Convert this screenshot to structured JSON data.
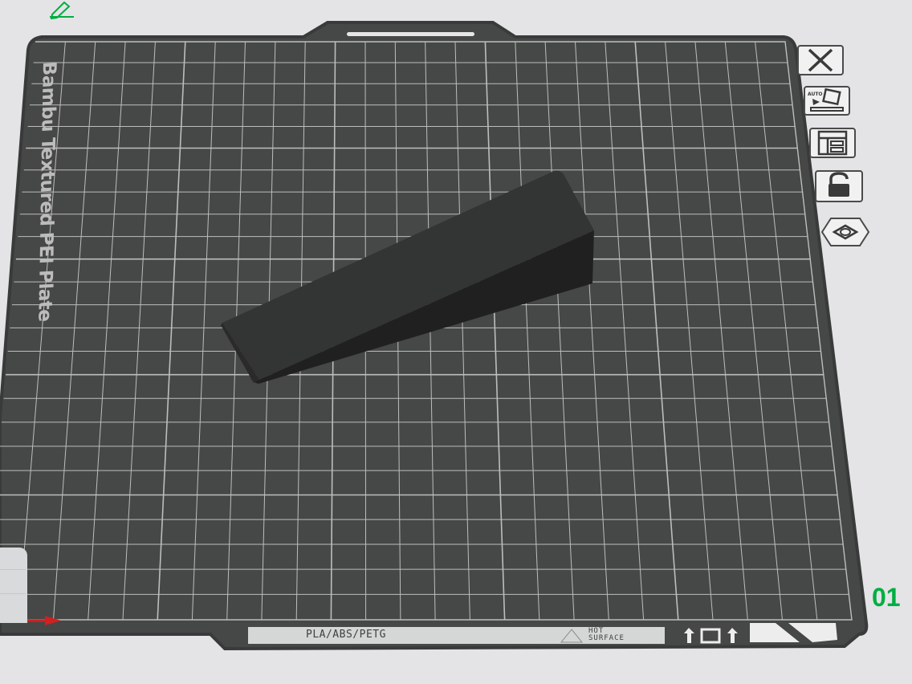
{
  "plate": {
    "label": "Bambu Textured PEI Plate",
    "number": "01",
    "material": "PLA/ABS/PETG",
    "hot_surface": [
      "HOT",
      "SURFACE"
    ]
  },
  "toolbar": {
    "buttons": [
      {
        "name": "close-plate-button",
        "icon": "close-icon"
      },
      {
        "name": "auto-orient-button",
        "icon": "auto-orient-icon",
        "text": "AUTO"
      },
      {
        "name": "arrange-button",
        "icon": "arrange-icon"
      },
      {
        "name": "lock-plate-button",
        "icon": "lock-icon"
      },
      {
        "name": "plate-settings-button",
        "icon": "hexagon-nut-icon"
      }
    ]
  },
  "colors": {
    "background": "#e4e4e6",
    "plate": "#464747",
    "plate_frame": "#3a3b3b",
    "grid_line": "#bdbdbd",
    "model": "#2e2e2e",
    "accent_green": "#00ae42",
    "axis_red": "#d0201f"
  }
}
